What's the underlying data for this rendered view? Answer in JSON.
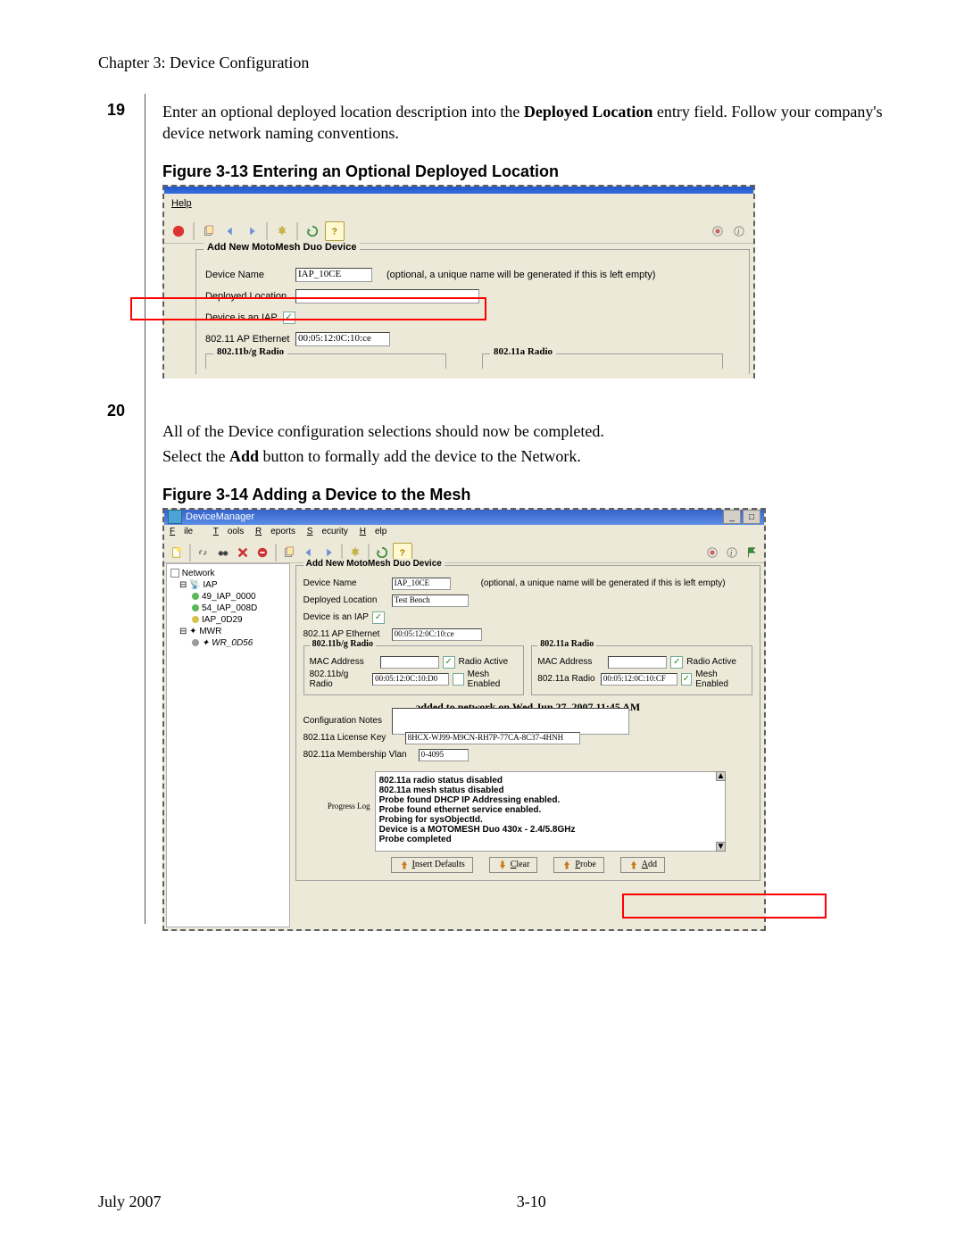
{
  "doc": {
    "chapter_header": "Chapter 3: Device Configuration",
    "footer_date": "July 2007",
    "page_number": "3-10"
  },
  "steps": {
    "s19": {
      "num": "19",
      "text_a": "Enter an optional deployed location description into the ",
      "text_bold": "Deployed Location",
      "text_b": " entry field.  Follow your company's device network naming conventions."
    },
    "s20": {
      "num": "20",
      "line1": "All of the Device configuration selections should now be completed.",
      "line2a": "Select the ",
      "line2bold": "Add",
      "line2b": " button to formally add the device to the Network."
    }
  },
  "captions": {
    "fig13": "Figure 3-13      Entering an Optional Deployed Location",
    "fig14": "Figure 3-14      Adding a Device to the Mesh"
  },
  "fig13": {
    "menu_help": "Help",
    "fs_title": "Add New MotoMesh Duo Device",
    "device_name_lbl": "Device Name",
    "device_name_val": "IAP_10CE",
    "device_name_note": "(optional, a unique name will be generated if this is left empty)",
    "deployed_loc_lbl": "Deployed Location",
    "deployed_loc_val": "",
    "is_iap_lbl": "Device is an IAP",
    "ap_eth_lbl": "802.11 AP Ethernet",
    "ap_eth_val": "00:05:12:0C:10:ce",
    "radio_bg": "802.11b/g Radio",
    "radio_a": "802.11a Radio"
  },
  "fig14": {
    "window_title": "DeviceManager",
    "menu": {
      "file": "File",
      "tools": "Tools",
      "reports": "Reports",
      "security": "Security",
      "help": "Help"
    },
    "tree": {
      "root": "Network",
      "iap": "IAP",
      "n1": "49_IAP_0000",
      "n2": "54_IAP_008D",
      "n3": "IAP_0D29",
      "mwr": "MWR",
      "n4": "WR_0D56"
    },
    "form": {
      "fs_title": "Add New MotoMesh Duo Device",
      "device_name_lbl": "Device Name",
      "device_name_val": "IAP_10CE",
      "device_name_note": "(optional, a unique name will be generated if this is left empty)",
      "deployed_loc_lbl": "Deployed Location",
      "deployed_loc_val": "Test Bench",
      "is_iap_lbl": "Device is an IAP",
      "ap_eth_lbl": "802.11 AP Ethernet",
      "ap_eth_val": "00:05:12:0C:10:ce",
      "bg": {
        "title": "802.11b/g Radio",
        "mac_lbl": "MAC Address",
        "active_lbl": "Radio Active",
        "radio_lbl": "802.11b/g Radio",
        "radio_val": "00:05:12:0C:10:D0",
        "mesh_lbl": "Mesh Enabled"
      },
      "a": {
        "title": "802.11a Radio",
        "mac_lbl": "MAC Address",
        "active_lbl": "Radio Active",
        "radio_lbl": "802.11a Radio",
        "radio_val": "00:05:12:0C:10:CF",
        "mesh_lbl": "Mesh Enabled"
      },
      "banner": "added to network on Wed Jun 27, 2007 11:45 AM",
      "cfg_notes_lbl": "Configuration Notes",
      "lic_lbl": "802.11a License Key",
      "lic_val": "8HCX-WJ99-M9CN-RH7P-77CA-8C37-4HNH",
      "vlan_lbl": "802.11a Membership Vlan",
      "vlan_val": "0-4095",
      "progress_lbl": "Progress Log",
      "progress_lines": [
        "802.11a radio status disabled",
        "802.11a mesh status disabled",
        "Probe found DHCP IP Addressing enabled.",
        "Probe found ethernet service enabled.",
        "Probing for sysObjectId.",
        "Device is a MOTOMESH Duo 430x - 2.4/5.8GHz",
        "Probe completed"
      ],
      "buttons": {
        "defaults": "Insert Defaults",
        "clear": "Clear",
        "probe": "Probe",
        "add": "Add"
      }
    }
  }
}
